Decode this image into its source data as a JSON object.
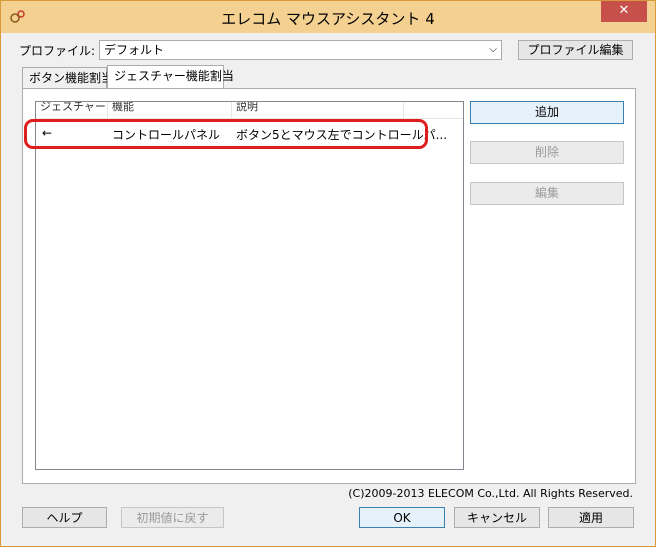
{
  "window": {
    "title": "エレコム マウスアシスタント 4",
    "close_label": "✕"
  },
  "profile": {
    "label": "プロファイル:",
    "selected": "デフォルト",
    "edit_button": "プロファイル編集"
  },
  "tabs": [
    {
      "label": "ボタン機能割当",
      "active": false
    },
    {
      "label": "ジェスチャー機能割当",
      "active": true
    }
  ],
  "list": {
    "columns": [
      "ジェスチャー",
      "機能",
      "説明"
    ],
    "rows": [
      {
        "gesture": "←",
        "function": "コントロールパネル",
        "description": "ボタン5とマウス左でコントロールパ..."
      }
    ]
  },
  "side_buttons": {
    "add": "追加",
    "delete": "削除",
    "edit": "編集"
  },
  "footer": {
    "copyright": "(C)2009-2013 ELECOM Co.,Ltd. All Rights Reserved.",
    "help": "ヘルプ",
    "reset": "初期値に戻す",
    "ok": "OK",
    "cancel": "キャンセル",
    "apply": "適用"
  },
  "colors": {
    "titlebar": "#f4d191",
    "close": "#c7504b",
    "highlight": "#e01d1d"
  }
}
